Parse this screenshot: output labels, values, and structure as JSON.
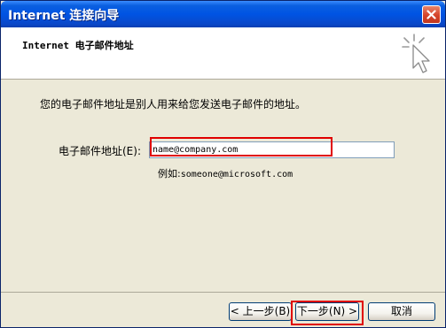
{
  "window": {
    "title": "Internet 连接向导"
  },
  "header": {
    "title": "Internet 电子邮件地址"
  },
  "main": {
    "description": "您的电子邮件地址是别人用来给您发送电子邮件的地址。",
    "email_label": "电子邮件地址(E):",
    "email_value": "name@company.com",
    "example_prefix": "例如:",
    "example_value": "someone@microsoft.com"
  },
  "footer": {
    "back_label": "< 上一步(B)",
    "next_label": "下一步(N) >",
    "cancel_label": "取消"
  },
  "colors": {
    "titlebar": "#0054e3",
    "highlight": "#e00000",
    "dialog_bg": "#ece9d8"
  },
  "icons": [
    "close-icon",
    "wizard-cursor-icon"
  ]
}
